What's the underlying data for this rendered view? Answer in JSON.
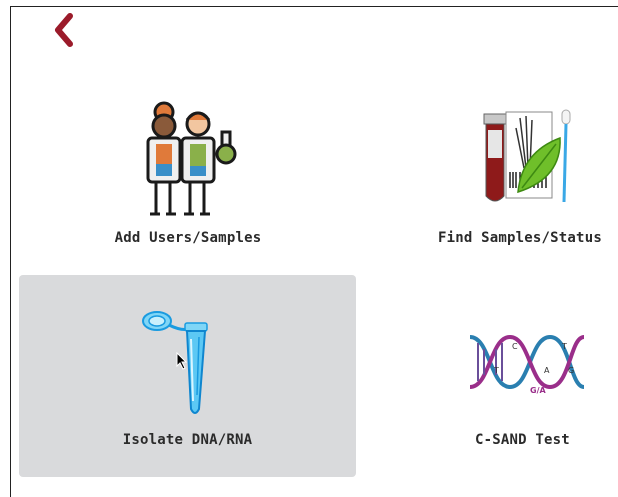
{
  "nav": {
    "back_icon": "chevron-left-icon",
    "accent": "#9b1b2a"
  },
  "tiles": [
    {
      "label": "Add Users/Samples",
      "icon": "scientists-icon",
      "selected": false
    },
    {
      "label": "Find Samples/Status",
      "icon": "sample-tube-leaf-icon",
      "selected": false
    },
    {
      "label": "Isolate DNA/RNA",
      "icon": "microcentrifuge-tube-icon",
      "selected": true
    },
    {
      "label": "C-SAND Test",
      "icon": "dna-helix-icon",
      "selected": false
    }
  ],
  "dna_icon_letters": [
    "C",
    "T",
    "T",
    "A",
    "G",
    "G/A"
  ],
  "colors": {
    "selected_tile_bg": "#d9dadc",
    "label": "#2b2b2b"
  }
}
